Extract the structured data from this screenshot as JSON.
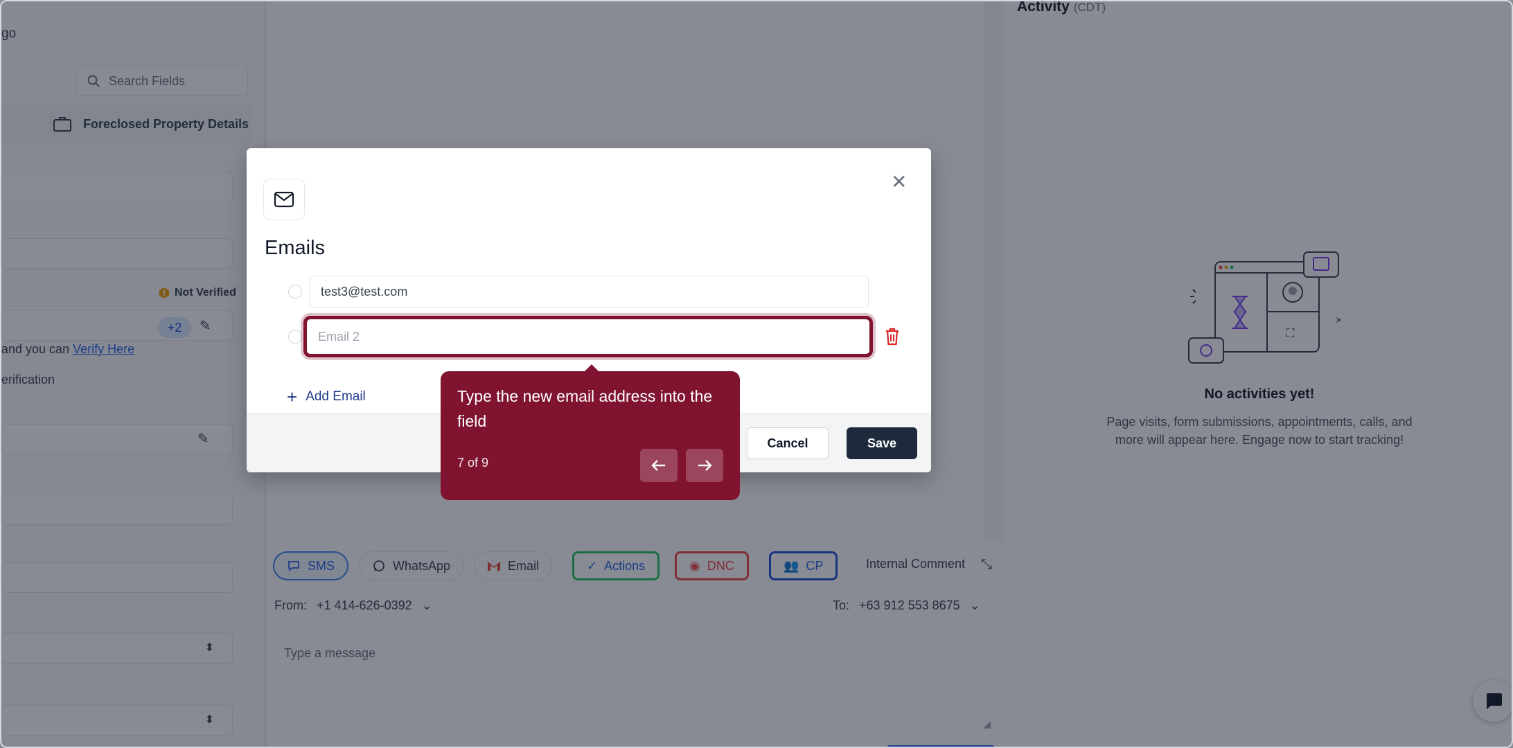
{
  "left_panel": {
    "crumb": "go",
    "search_placeholder": "Search Fields",
    "tab_label": "Foreclosed Property Details",
    "not_verified": "Not Verified",
    "plus_count": "+2",
    "verify_prefix": " and you can ",
    "verify_link": "Verify Here",
    "verification_text": "erification"
  },
  "channels": {
    "sms": "SMS",
    "whatsapp": "WhatsApp",
    "email": "Email",
    "actions": "Actions",
    "dnc": "DNC",
    "cp": "CP",
    "internal_comment": "Internal Comment"
  },
  "composer": {
    "from_label": "From:",
    "from_value": "+1 414-626-0392",
    "to_label": "To:",
    "to_value": "+63 912 553 8675",
    "message_placeholder": "Type a message"
  },
  "activity": {
    "title": "Activity",
    "timezone": "(CDT)",
    "empty_title": "No activities yet!",
    "empty_desc": "Page visits, form submissions, appointments, calls, and more will appear here. Engage now to start tracking!"
  },
  "modal": {
    "title": "Emails",
    "email_1_value": "test3@test.com",
    "email_2_placeholder": "Email 2",
    "add_email": "Add Email",
    "cancel": "Cancel",
    "save": "Save"
  },
  "tour": {
    "text": "Type the new email address into the field",
    "step": "7 of 9"
  },
  "colors": {
    "accent": "#7f1330",
    "save_button": "#1e293b",
    "link": "#2563eb",
    "danger": "#dc2626"
  },
  "icons": [
    "search-icon",
    "briefcase-icon",
    "warning-hex-icon",
    "pencil-icon",
    "mail-icon",
    "close-icon",
    "trash-icon",
    "plus-icon",
    "arrow-left-icon",
    "arrow-right-icon",
    "chat-icon"
  ]
}
